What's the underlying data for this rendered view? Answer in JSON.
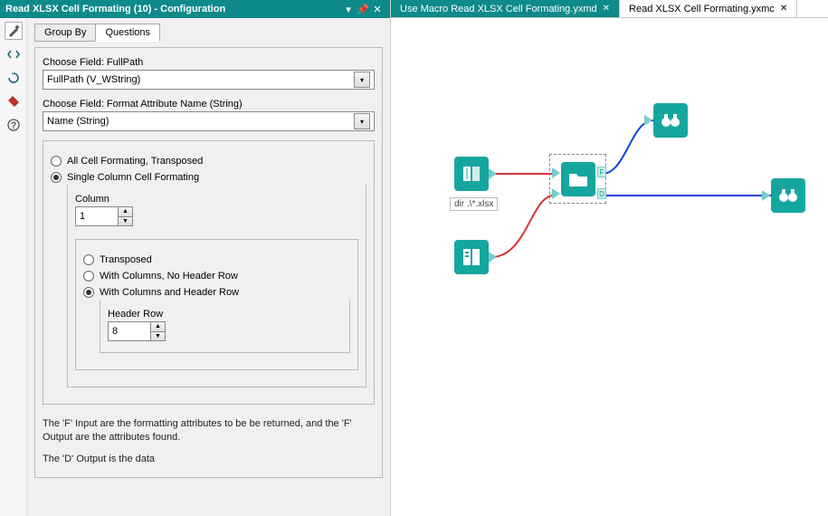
{
  "panel": {
    "title": "Read XLSX Cell Formating (10) - Configuration",
    "dropdown_icon": "▾",
    "pin_icon": "📌",
    "close_icon": "✕"
  },
  "toolbar": {
    "wand": "wand",
    "code": "code",
    "refresh": "refresh",
    "tag": "tag",
    "help": "help"
  },
  "tabs": {
    "group_by": "Group By",
    "questions": "Questions"
  },
  "config": {
    "field1_label": "Choose Field: FullPath",
    "field1_value": "FullPath (V_WString)",
    "field2_label": "Choose Field: Format Attribute Name (String)",
    "field2_value": "Name (String)",
    "radio_all": "All Cell Formating, Transposed",
    "radio_single": "Single Column Cell Formating",
    "column_label": "Column",
    "column_value": "1",
    "radio_transposed": "Transposed",
    "radio_withcols_nohdr": "With Columns, No Header Row",
    "radio_withcols_hdr": "With Columns and Header Row",
    "header_row_label": "Header Row",
    "header_row_value": "8",
    "help1": "The 'F' Input are the formatting attributes to be be returned, and the 'F' Output are the attributes found.",
    "help2": "The 'D' Output is the data"
  },
  "doc_tabs": {
    "tab1": "Use Macro Read XLSX Cell Formating.yxmd",
    "tab2": "Read XLSX Cell Formating.yxmc",
    "close": "✕"
  },
  "canvas": {
    "dir_label": "dir .\\*.xlsx",
    "anchor_f": "F",
    "anchor_d": "D"
  }
}
